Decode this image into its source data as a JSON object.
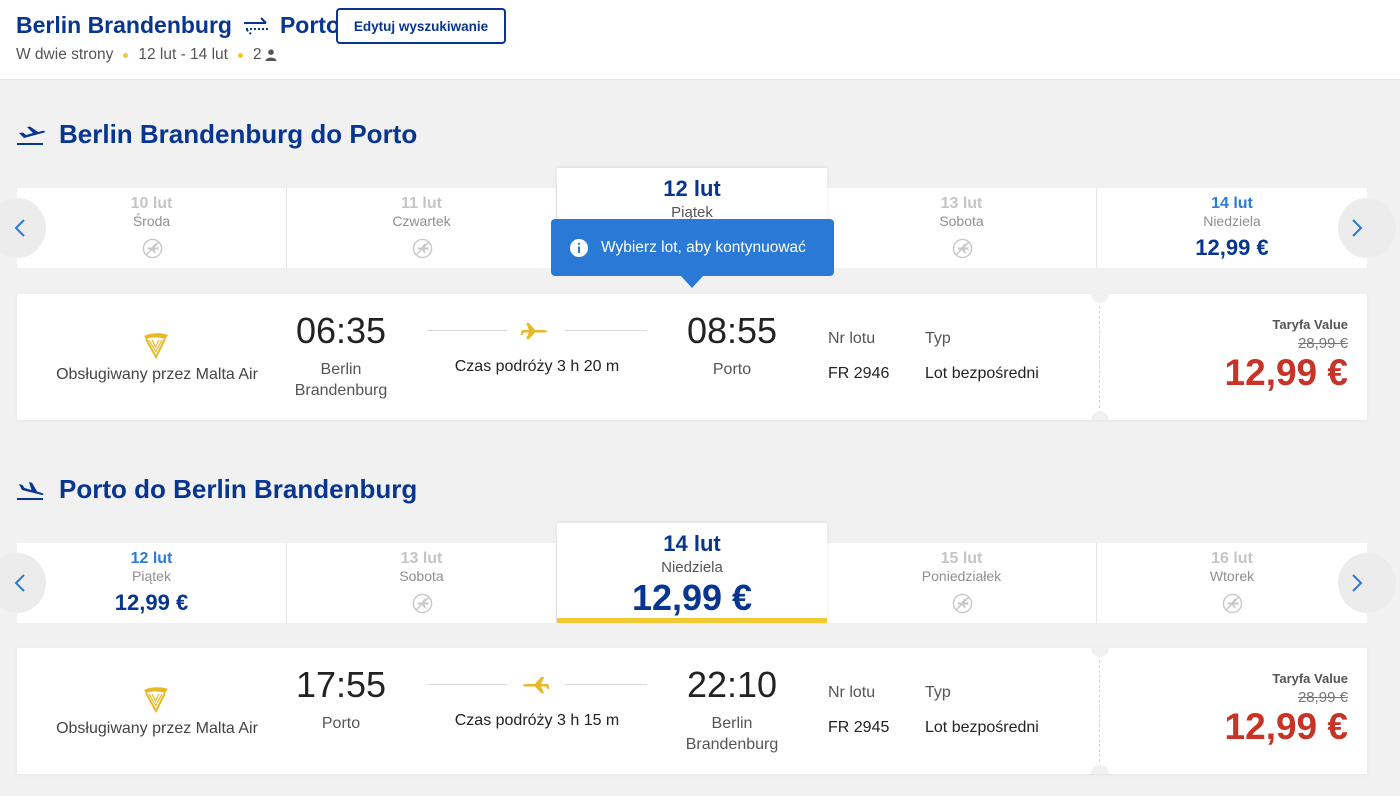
{
  "header": {
    "origin": "Berlin Brandenburg",
    "destination": "Porto",
    "trip_type": "W dwie strony",
    "dates": "12 lut - 14 lut",
    "passengers": "2",
    "edit_button": "Edytuj wyszukiwanie",
    "icons": [
      "round-trip-arrows-icon",
      "person-icon"
    ]
  },
  "tooltip": {
    "text": "Wybierz lot, aby kontynuować",
    "icon": "info-icon"
  },
  "outbound": {
    "title": "Berlin Brandenburg do Porto",
    "icon": "plane-departure-icon",
    "dates": [
      {
        "date": "10 lut",
        "weekday": "Środa",
        "price": "",
        "available": false
      },
      {
        "date": "11 lut",
        "weekday": "Czwartek",
        "price": "",
        "available": false
      },
      {
        "date": "12 lut",
        "weekday": "Piątek",
        "price": "",
        "available": true,
        "selected": true
      },
      {
        "date": "13 lut",
        "weekday": "Sobota",
        "price": "",
        "available": false
      },
      {
        "date": "14 lut",
        "weekday": "Niedziela",
        "price": "12,99 €",
        "available": true
      }
    ],
    "flight": {
      "operator": "Obsługiwany przez Malta Air",
      "dep_time": "06:35",
      "dep_city": "Berlin Brandenburg",
      "arr_time": "08:55",
      "arr_city": "Porto",
      "duration": "Czas podróży 3 h 20 m",
      "flight_no_label": "Nr lotu",
      "flight_no": "FR 2946",
      "type_label": "Typ",
      "type": "Lot bezpośredni",
      "fare_name": "Taryfa Value",
      "old_price": "28,99 €",
      "price": "12,99 €"
    }
  },
  "inbound": {
    "title": "Porto do Berlin Brandenburg",
    "icon": "plane-arrival-icon",
    "dates": [
      {
        "date": "12 lut",
        "weekday": "Piątek",
        "price": "12,99 €",
        "available": true
      },
      {
        "date": "13 lut",
        "weekday": "Sobota",
        "price": "",
        "available": false
      },
      {
        "date": "14 lut",
        "weekday": "Niedziela",
        "price": "12,99 €",
        "available": true,
        "selected": true
      },
      {
        "date": "15 lut",
        "weekday": "Poniedziałek",
        "price": "",
        "available": false
      },
      {
        "date": "16 lut",
        "weekday": "Wtorek",
        "price": "",
        "available": false
      }
    ],
    "flight": {
      "operator": "Obsługiwany przez Malta Air",
      "dep_time": "17:55",
      "dep_city": "Porto",
      "arr_time": "22:10",
      "arr_city": "Berlin Brandenburg",
      "duration": "Czas podróży 3 h 15 m",
      "flight_no_label": "Nr lotu",
      "flight_no": "FR 2945",
      "type_label": "Typ",
      "type": "Lot bezpośredni",
      "fare_name": "Taryfa Value",
      "old_price": "28,99 €",
      "price": "12,99 €"
    }
  },
  "colors": {
    "brand_blue": "#073590",
    "accent_yellow": "#f1c933",
    "price_red": "#c83327",
    "tooltip_blue": "#2a79d6"
  }
}
